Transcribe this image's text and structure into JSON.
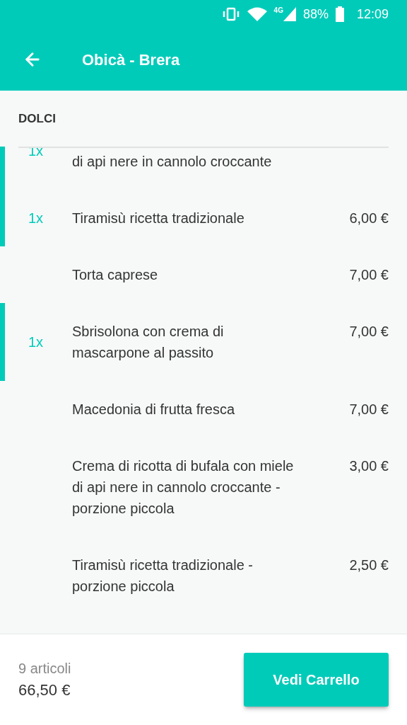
{
  "status_bar": {
    "network": "4G",
    "battery": "88%",
    "time": "12:09"
  },
  "header": {
    "title": "Obicà - Brera"
  },
  "section": {
    "title": "DOLCI"
  },
  "items": [
    {
      "quantity": "1x",
      "lines": [
        "di api nere in cannolo croccante"
      ],
      "selected": true,
      "partial": true
    },
    {
      "quantity": "1x",
      "lines": [
        "Tiramisù ricetta tradizionale"
      ],
      "price": "6,00 €",
      "selected": true
    },
    {
      "lines": [
        "Torta caprese"
      ],
      "price": "7,00 €",
      "selected": false
    },
    {
      "quantity": "1x",
      "lines": [
        "Sbrisolona con crema di",
        "mascarpone al passito"
      ],
      "price": "7,00 €",
      "selected": true
    },
    {
      "lines": [
        "Macedonia di frutta fresca"
      ],
      "price": "7,00 €",
      "selected": false
    },
    {
      "lines": [
        "Crema di ricotta di bufala con miele",
        "di api nere in cannolo croccante -",
        "porzione piccola"
      ],
      "price": "3,00 €",
      "selected": false
    },
    {
      "lines": [
        "Tiramisù ricetta tradizionale -",
        "porzione piccola"
      ],
      "price": "2,50 €",
      "selected": false
    }
  ],
  "footer": {
    "count": "9 articoli",
    "total": "66,50 €",
    "button": "Vedi Carrello"
  }
}
